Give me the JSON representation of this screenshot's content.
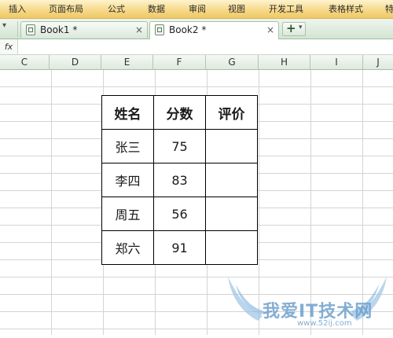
{
  "ribbon": {
    "tabs": [
      "插入",
      "页面布局",
      "公式",
      "数据",
      "审阅",
      "视图",
      "开发工具",
      "表格样式",
      "特"
    ]
  },
  "doc_tabs": [
    {
      "label": "Book1 *",
      "active": false
    },
    {
      "label": "Book2 *",
      "active": true
    }
  ],
  "tabbar": {
    "close_glyph": "×",
    "new_tab_glyph": "+",
    "dropdown_glyph": "▾",
    "left_glyph": "▾"
  },
  "formula_bar": {
    "fx_label": "fx",
    "value": ""
  },
  "columns": [
    "C",
    "D",
    "E",
    "F",
    "G",
    "H",
    "I",
    "J"
  ],
  "table": {
    "headers": [
      "姓名",
      "分数",
      "评价"
    ],
    "rows": [
      [
        "张三",
        "75",
        ""
      ],
      [
        "李四",
        "83",
        ""
      ],
      [
        "周五",
        "56",
        ""
      ],
      [
        "郑六",
        "91",
        ""
      ]
    ]
  },
  "watermark": {
    "text": "我爱IT技术网",
    "url": "www.52ij.com"
  },
  "colors": {
    "ribbon": "#f6d98a",
    "tabbar": "#d3e5d3",
    "header": "#dfeadf",
    "watermark": "#6ea0cc"
  }
}
